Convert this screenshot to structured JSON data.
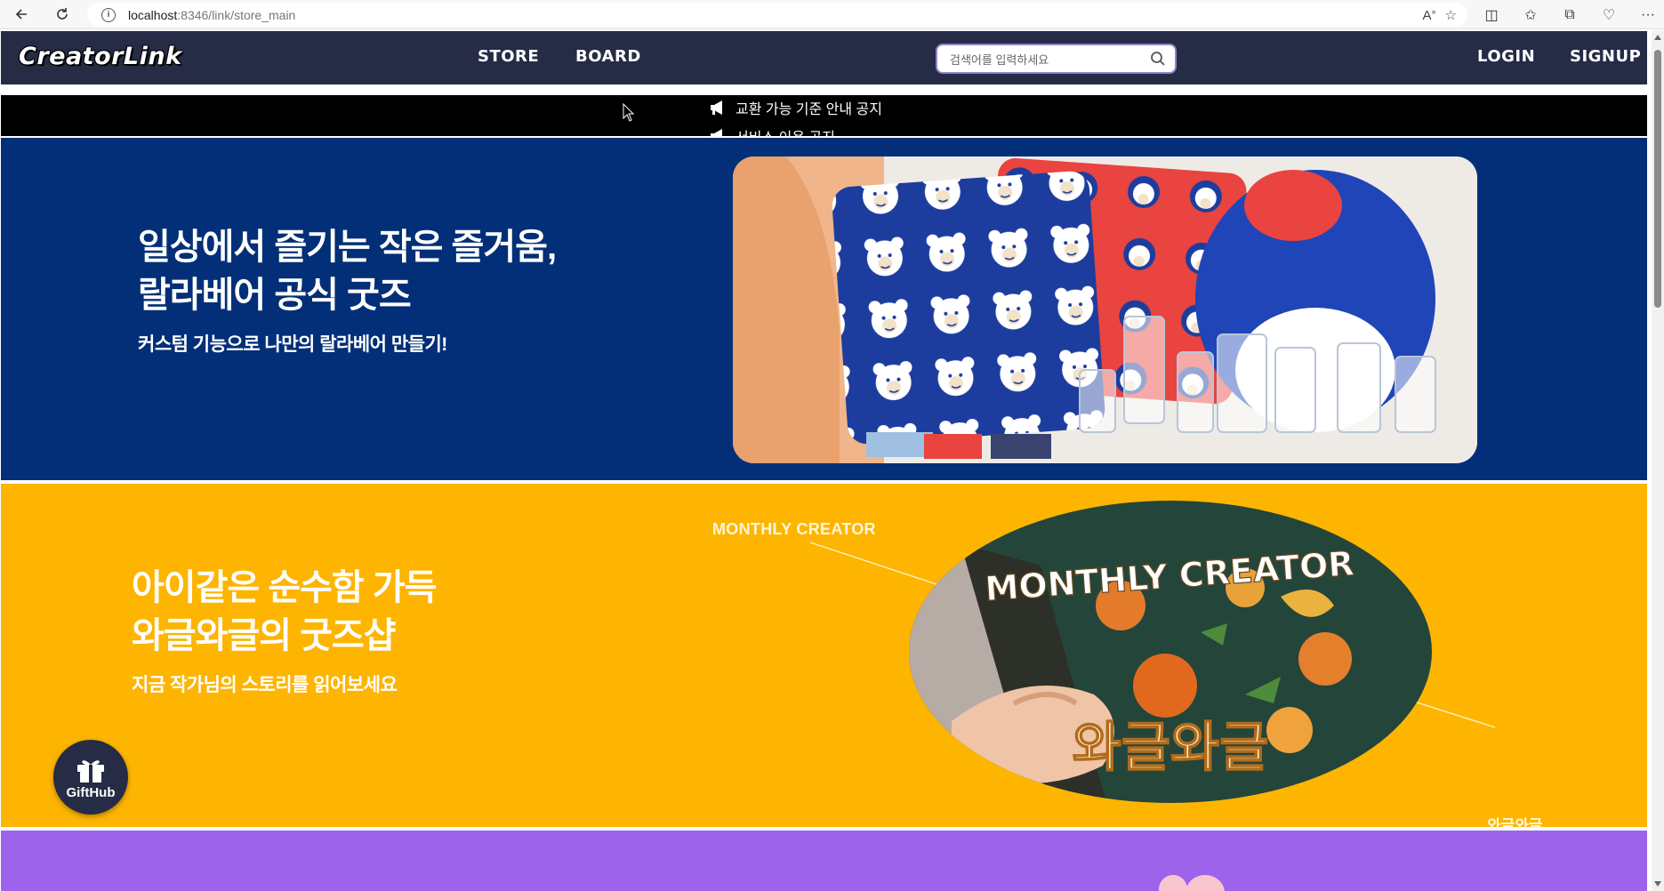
{
  "browser": {
    "url_host": "localhost",
    "url_port_path": ":8346/link/store_main"
  },
  "header": {
    "logo": "CreatorLink",
    "nav": [
      "STORE",
      "BOARD"
    ],
    "search_placeholder": "검색어를 입력하세요",
    "login": "LOGIN",
    "signup": "SIGNUP",
    "colors": {
      "bar": "#262b46",
      "search_border": "#8d86c9"
    }
  },
  "notices": [
    "교환 가능 기준 안내 공지",
    "서비스 이용 공지"
  ],
  "banners": [
    {
      "headline_line1": "일상에서 즐기는 작은 즐거움,",
      "headline_line2": "랄라베어 공식 굿즈",
      "subline": "커스텀 기능으로 나만의 랄라베어 만들기!",
      "color": "#022f77"
    },
    {
      "headline_line1": "아이같은 순수함 가득",
      "headline_line2": "와글와글의 굿즈샵",
      "subline": "지금 작가님의 스토리를 읽어보세요",
      "tag": "MONTHLY CREATOR",
      "image_title": "MONTHLY CREATOR",
      "image_name": "와글와글",
      "creator_name": "와글와글",
      "color": "#fdb501"
    },
    {
      "color": "#9d63ea"
    }
  ],
  "gifthub": {
    "label": "GiftHub",
    "icon": "gift-icon"
  }
}
